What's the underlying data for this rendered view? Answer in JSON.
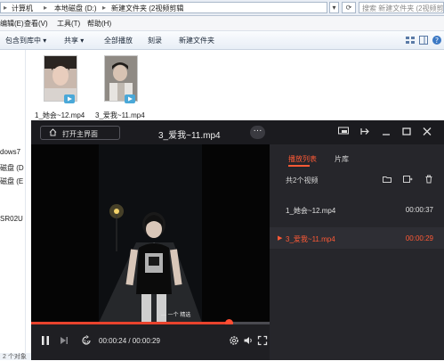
{
  "explorer": {
    "breadcrumb": [
      "计算机",
      "本地磁盘 (D:)",
      "新建文件夹 (2视频剪辑"
    ],
    "search_placeholder": "搜索 新建文件夹 (2视频剪辑)",
    "menu": [
      "编辑(E)",
      "查看(V)",
      "工具(T)",
      "帮助(H)"
    ],
    "toolbar": [
      "包含到库中 ▾",
      "共享 ▾",
      "全部播放",
      "刻录",
      "新建文件夹"
    ],
    "left_pane": [
      "dows7",
      "磁盘 (D",
      "磁盘 (E",
      "SR02U"
    ],
    "files": [
      {
        "name": "1_她会~12.mp4"
      },
      {
        "name": "3_爱我~11.mp4"
      }
    ],
    "status": "2 个对象"
  },
  "player": {
    "home_button": "打开主界面",
    "title": "3_爱我~11.mp4",
    "more_label": "···",
    "tabs": [
      "播放列表",
      "片库"
    ],
    "count_label": "共2个视频",
    "playlist": [
      {
        "name": "1_她会~12.mp4",
        "duration": "00:00:37",
        "active": false
      },
      {
        "name": "3_爱我~11.mp4",
        "duration": "00:00:29",
        "active": true
      }
    ],
    "time_display": "00:00:24 / 00:00:29",
    "progress": 0.83,
    "video_caption": "— 一个    精选",
    "accent_color": "#ff5a36"
  }
}
